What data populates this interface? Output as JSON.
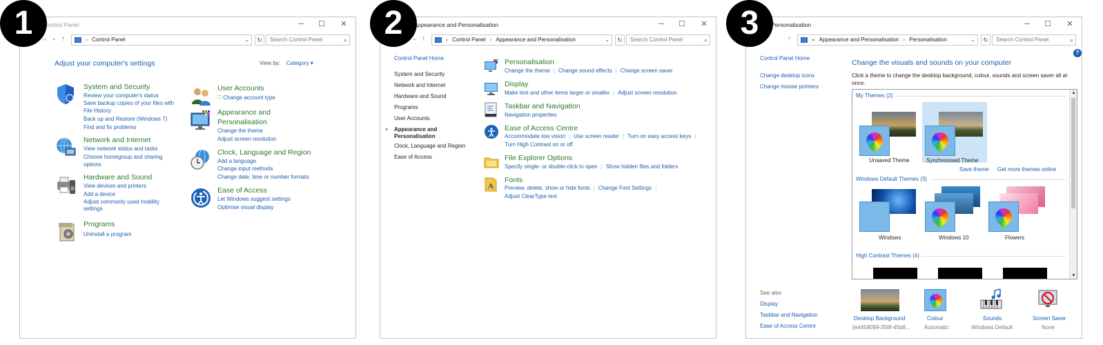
{
  "badges": [
    "1",
    "2",
    "3"
  ],
  "p1": {
    "title": "Control Panel",
    "address": "Control Panel",
    "search_placeholder": "Search Control Panel",
    "heading": "Adjust your computer's settings",
    "view_by_label": "View by:",
    "view_by_value": "Category",
    "categories": [
      {
        "title": "System and Security",
        "links": [
          "Review your computer's status",
          "Save backup copies of your files with",
          "File History",
          "Back up and Restore (Windows 7)",
          "Find and fix problems"
        ]
      },
      {
        "title": "Network and Internet",
        "links": [
          "View network status and tasks",
          "Choose homegroup and sharing",
          "options"
        ]
      },
      {
        "title": "Hardware and Sound",
        "links": [
          "View devices and printers",
          "Add a device",
          "Adjust commonly used mobility",
          "settings"
        ]
      },
      {
        "title": "Programs",
        "links": [
          "Uninstall a program"
        ]
      },
      {
        "title": "User Accounts",
        "links": [
          "Change account type"
        ]
      },
      {
        "title": "Appearance and",
        "title2": "Personalisation",
        "links": [
          "Change the theme",
          "Adjust screen resolution"
        ]
      },
      {
        "title": "Clock, Language and Region",
        "links": [
          "Add a language",
          "Change input methods",
          "Change date, time or number formats"
        ]
      },
      {
        "title": "Ease of Access",
        "links": [
          "Let Windows suggest settings",
          "Optimise visual display"
        ]
      }
    ]
  },
  "p2": {
    "title": "Appearance and Personalisation",
    "address": [
      "Control Panel",
      "Appearance and Personalisation"
    ],
    "search_placeholder": "Search Control Panel",
    "nav": [
      "Control Panel Home",
      "System and Security",
      "Network and Internet",
      "Hardware and Sound",
      "Programs",
      "User Accounts",
      "Appearance and",
      "Personalisation",
      "Clock, Language and Region",
      "Ease of Access"
    ],
    "sections": [
      {
        "title": "Personalisation",
        "links": [
          "Change the theme",
          "Change sound effects",
          "Change screen saver"
        ]
      },
      {
        "title": "Display",
        "links": [
          "Make text and other items larger or smaller",
          "Adjust screen resolution"
        ]
      },
      {
        "title": "Taskbar and Navigation",
        "links": [
          "Navigation properties"
        ]
      },
      {
        "title": "Ease of Access Centre",
        "links": [
          "Accommodate low vision",
          "Use screen reader",
          "Turn on easy access keys",
          "Turn High Contrast on or off"
        ]
      },
      {
        "title": "File Explorer Options",
        "links": [
          "Specify single- or double-click to open",
          "Show hidden files and folders"
        ]
      },
      {
        "title": "Fonts",
        "links": [
          "Preview, delete, show or hide fonts",
          "Change Font Settings",
          "Adjust ClearType text"
        ]
      }
    ]
  },
  "p3": {
    "title": "Personalisation",
    "address": [
      "«",
      "Appearance and Personalisation",
      "Personalisation"
    ],
    "search_placeholder": "Search Control Panel",
    "nav": [
      "Control Panel Home",
      "Change desktop icons",
      "Change mouse pointers"
    ],
    "heading": "Change the visuals and sounds on your computer",
    "description": "Click a theme to change the desktop background, colour, sounds and screen saver all at",
    "description2": "once.",
    "my_themes": "My Themes (2)",
    "my_theme_items": [
      "Unsaved Theme",
      "Synchronised Theme"
    ],
    "save_theme": "Save theme",
    "get_more": "Get more themes online",
    "default_themes": "Windows Default Themes (3)",
    "default_theme_items": [
      "Windows",
      "Windows 10",
      "Flowers"
    ],
    "high_contrast": "High Contrast Themes (4)",
    "see_also": "See also",
    "see_also_links": [
      "Display",
      "Taskbar and Navigation",
      "Ease of Access Centre"
    ],
    "bottom": [
      {
        "label": "Desktop Background",
        "sub": "{e4459099-358f-45b8..."
      },
      {
        "label": "Colour",
        "sub": "Automatic"
      },
      {
        "label": "Sounds",
        "sub": "Windows Default"
      },
      {
        "label": "Screen Saver",
        "sub": "None"
      }
    ]
  }
}
